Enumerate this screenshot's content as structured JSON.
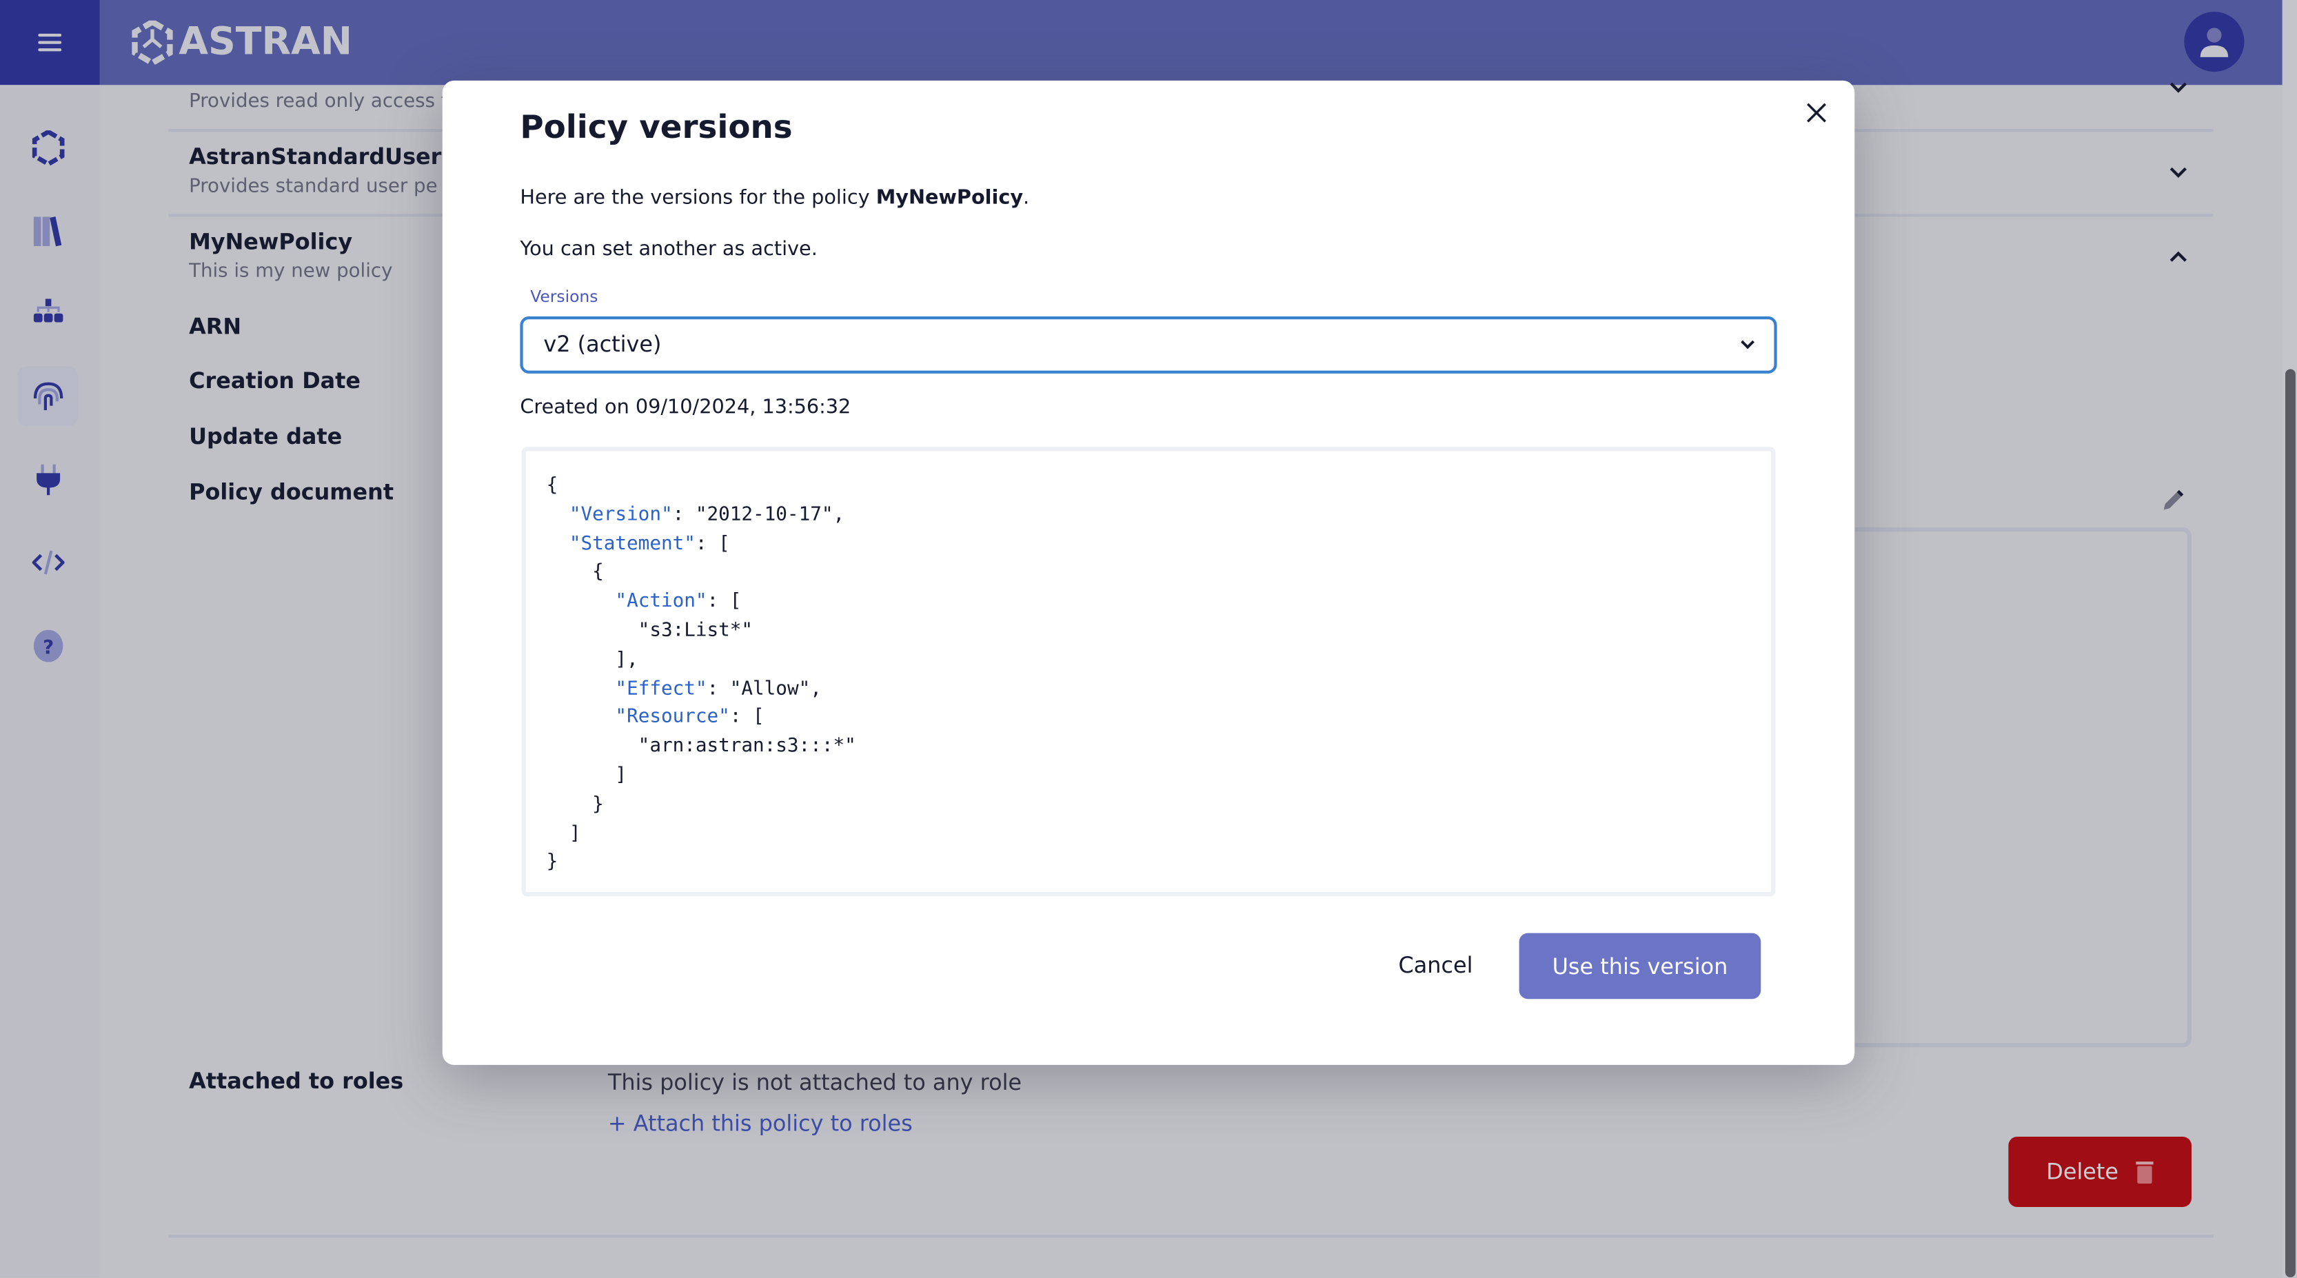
{
  "app": {
    "brand": "ASTRAN",
    "accent": "#2b318a",
    "topbar_color": "#51599c"
  },
  "sidebar": {
    "items": [
      {
        "icon": "astran-logo-icon"
      },
      {
        "icon": "library-icon"
      },
      {
        "icon": "hierarchy-icon"
      },
      {
        "icon": "fingerprint-icon",
        "selected": true
      },
      {
        "icon": "plug-icon"
      },
      {
        "icon": "code-icon"
      },
      {
        "icon": "help-icon"
      }
    ]
  },
  "policies": [
    {
      "name": "",
      "description": "Provides read only access t"
    },
    {
      "name": "AstranStandardUser",
      "description": "Provides standard user pe"
    },
    {
      "name": "MyNewPolicy",
      "description": "This is my new policy"
    }
  ],
  "details": {
    "arn_label": "ARN",
    "creation_label": "Creation Date",
    "update_label": "Update date",
    "document_label": "Policy document",
    "attached_label": "Attached to roles",
    "attached_text": "This policy is not attached to any role",
    "attach_link": "+ Attach this policy to roles",
    "delete_label": "Delete"
  },
  "modal": {
    "title": "Policy versions",
    "intro_prefix": "Here are the versions for the policy ",
    "policy_name": "MyNewPolicy",
    "intro_suffix": ".",
    "hint": "You can set another as active.",
    "versions_label": "Versions",
    "selected_version": "v2 (active)",
    "created_on": "Created on 09/10/2024, 13:56:32",
    "document": {
      "Version": "2012-10-17",
      "Action": "s3:List*",
      "Effect": "Allow",
      "Resource": "arn:astran:s3:::*"
    },
    "cancel_label": "Cancel",
    "use_label": "Use this version"
  }
}
